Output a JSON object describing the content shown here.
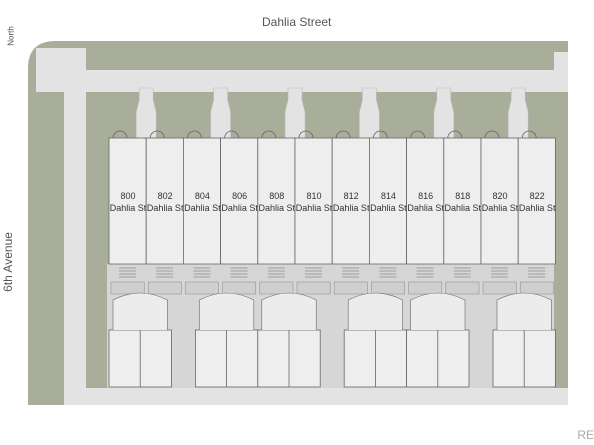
{
  "labels": {
    "top_street": "Dahlia Street",
    "left_street": "6th Avenue",
    "north": "North",
    "watermark": "REc"
  },
  "units": [
    {
      "number": "800",
      "street": "Dahlia St"
    },
    {
      "number": "802",
      "street": "Dahlia St"
    },
    {
      "number": "804",
      "street": "Dahlia St"
    },
    {
      "number": "806",
      "street": "Dahlia St"
    },
    {
      "number": "808",
      "street": "Dahlia St"
    },
    {
      "number": "810",
      "street": "Dahlia St"
    },
    {
      "number": "812",
      "street": "Dahlia St"
    },
    {
      "number": "814",
      "street": "Dahlia St"
    },
    {
      "number": "816",
      "street": "Dahlia St"
    },
    {
      "number": "818",
      "street": "Dahlia St"
    },
    {
      "number": "820",
      "street": "Dahlia St"
    },
    {
      "number": "822",
      "street": "Dahlia St"
    }
  ],
  "colors": {
    "lawn": "#a9ae9b",
    "sidewalk": "#e3e3e3",
    "building": "#eeeeee",
    "outline": "#666666",
    "label": "#555555"
  }
}
